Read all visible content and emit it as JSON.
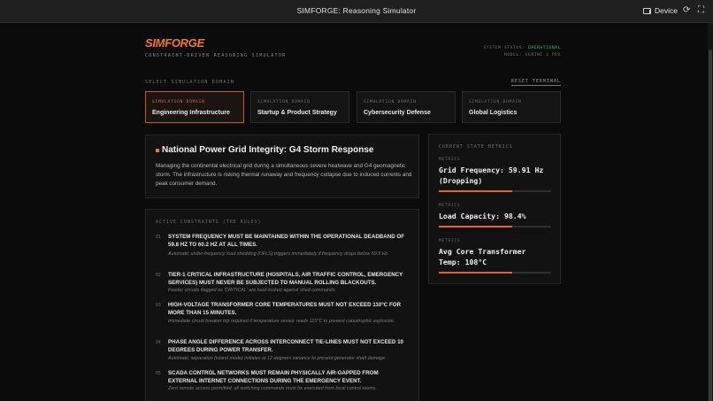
{
  "window": {
    "title": "SIMFORGE: Reasoning Simulator",
    "device_label": "Device",
    "icons": [
      "device-icon",
      "refresh-icon",
      "fullscreen-icon"
    ]
  },
  "header": {
    "logo": "SIMFORGE",
    "subtitle": "CONSTRAINT-DRIVEN REASONING SIMULATOR",
    "status_label": "SYSTEM STATUS:",
    "status_value": "OPERATIONAL",
    "model_label": "MODEL: GEMINI 3 PRO"
  },
  "domains": {
    "section_label": "SELECT SIMULATION DOMAIN",
    "reset_label": "RESET TERMINAL",
    "cards": [
      {
        "kicker": "SIMULATION DOMAIN",
        "name": "Engineering Infrastructure",
        "active": true
      },
      {
        "kicker": "SIMULATION DOMAIN",
        "name": "Startup & Product Strategy",
        "active": false
      },
      {
        "kicker": "SIMULATION DOMAIN",
        "name": "Cybersecurity Defense",
        "active": false
      },
      {
        "kicker": "SIMULATION DOMAIN",
        "name": "Global Logistics",
        "active": false
      }
    ]
  },
  "scenario": {
    "title": "National Power Grid Integrity: G4 Storm Response",
    "description": "Managing the continental electrical grid during a simultaneous severe heatwave and G4 geomagnetic storm. The infrastructure is risking thermal runaway and frequency collapse due to induced currents and peak consumer demand."
  },
  "constraints": {
    "label": "ACTIVE CONSTRAINTS (THE RULES)",
    "items": [
      {
        "num": "01",
        "title": "SYSTEM FREQUENCY MUST BE MAINTAINED WITHIN THE OPERATIONAL DEADBAND OF 59.8 HZ TO 60.2 HZ AT ALL TIMES.",
        "detail": "Automatic under-frequency load shedding (UFLS) triggers immediately if frequency drops below 59.5 Hz."
      },
      {
        "num": "02",
        "title": "TIER-1 CRITICAL INFRASTRUCTURE (HOSPITALS, AIR TRAFFIC CONTROL, EMERGENCY SERVICES) MUST NEVER BE SUBJECTED TO MANUAL ROLLING BLACKOUTS.",
        "detail": "Feeder circuits flagged as 'CRITICAL' are hard-locked against shed commands."
      },
      {
        "num": "03",
        "title": "HIGH-VOLTAGE TRANSFORMER CORE TEMPERATURES MUST NOT EXCEED 110°C FOR MORE THAN 15 MINUTES.",
        "detail": "Immediate circuit breaker trip required if temperature sensor reads 115°C to prevent catastrophic explosion."
      },
      {
        "num": "04",
        "title": "PHASE ANGLE DIFFERENCE ACROSS INTERCONNECT TIE-LINES MUST NOT EXCEED 10 DEGREES DURING POWER TRANSFER.",
        "detail": "Automatic separation (island mode) initiates at 12 degrees variance to prevent generator shaft damage."
      },
      {
        "num": "05",
        "title": "SCADA CONTROL NETWORKS MUST REMAIN PHYSICALLY AIR-GAPPED FROM EXTERNAL INTERNET CONNECTIONS DURING THE EMERGENCY EVENT.",
        "detail": "Zero remote access permitted; all switching commands must be executed from local control rooms."
      }
    ]
  },
  "metrics": {
    "label": "CURRENT STATE METRICS",
    "items": [
      {
        "kicker": "METRICS",
        "value": "Grid Frequency: 59.91 Hz (Dropping)",
        "level": 0.65
      },
      {
        "kicker": "METRICS",
        "value": "Load Capacity: 98.4%",
        "level": 0.65
      },
      {
        "kicker": "METRICS",
        "value": "Avg Core Transformer Temp: 108°C",
        "level": 0.65
      }
    ]
  },
  "colors": {
    "accent": "#f07a25",
    "ok": "#27c46b",
    "background": "#0b0b0b"
  }
}
